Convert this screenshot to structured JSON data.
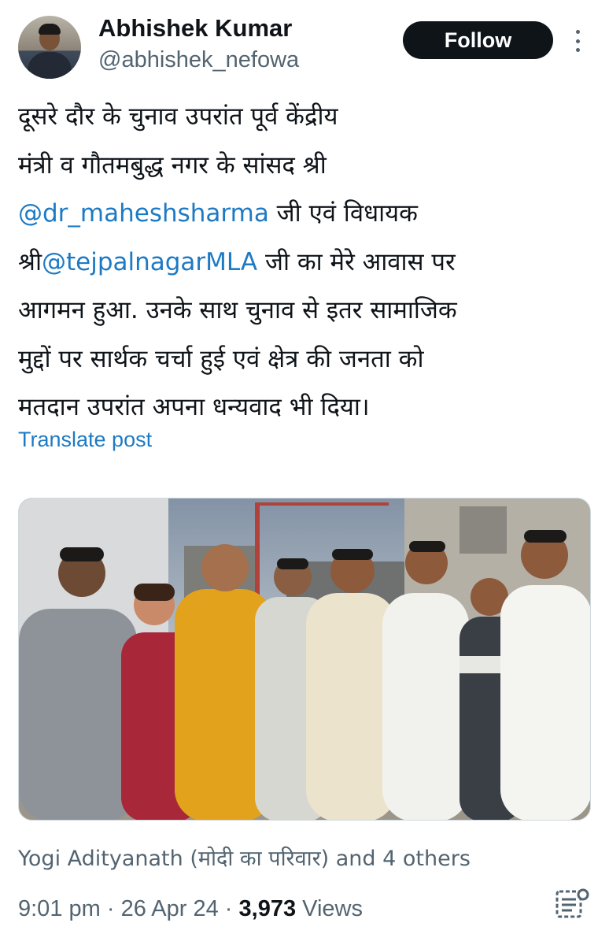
{
  "author": {
    "name": "Abhishek Kumar",
    "handle": "@abhishek_nefowa",
    "follow_label": "Follow",
    "more_icon": "ellipsis-vertical-icon"
  },
  "tweet": {
    "lines": [
      [
        {
          "text": "दूसरे दौर के चुनाव उपरांत पूर्व केंद्रीय"
        }
      ],
      [
        {
          "text": "मंत्री व गौतमबुद्ध नगर के सांसद श्री"
        }
      ],
      [
        {
          "text": "@dr_maheshsharma",
          "mention": true
        },
        {
          "text": " जी एवं विधायक"
        }
      ],
      [
        {
          "text": "श्री"
        },
        {
          "text": "@tejpalnagarMLA",
          "mention": true
        },
        {
          "text": " जी का मेरे आवास पर"
        }
      ],
      [
        {
          "text": "आगमन हुआ. उनके साथ चुनाव से इतर सामाजिक"
        }
      ],
      [
        {
          "text": "मुद्दों पर सार्थक चर्चा हुई एवं क्षेत्र की जनता को"
        }
      ],
      [
        {
          "text": "मतदान उपरांत अपना धन्यवाद भी दिया।"
        }
      ]
    ],
    "translate_label": "Translate post"
  },
  "photo": {
    "description_icon": "group-photo"
  },
  "social": {
    "liked_by": "Yogi Adityanath (मोदी का परिवार) and 4 others"
  },
  "meta": {
    "time": "9:01 pm",
    "separator": " · ",
    "date": "26 Apr 24",
    "views_count": "3,973",
    "views_label": " Views",
    "analytics_icon": "analytics-icon"
  },
  "colors": {
    "link": "#1d7ac4",
    "secondary": "#536471",
    "primary_text": "#0f1419"
  }
}
